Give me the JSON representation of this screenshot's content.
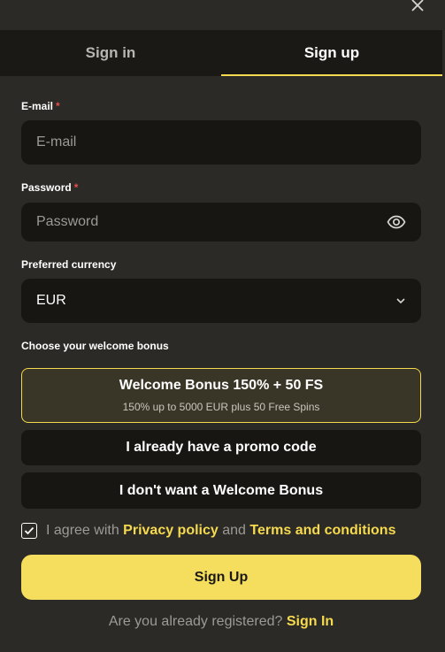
{
  "modal": {
    "close_icon": "close-icon"
  },
  "tabs": [
    {
      "label": "Sign in",
      "active": false
    },
    {
      "label": "Sign up",
      "active": true
    }
  ],
  "form": {
    "email": {
      "label": "E-mail",
      "required_mark": "*",
      "placeholder": "E-mail",
      "value": ""
    },
    "password": {
      "label": "Password",
      "required_mark": "*",
      "placeholder": "Password",
      "value": "",
      "toggle_icon": "eye-icon"
    },
    "currency": {
      "label": "Preferred currency",
      "value": "EUR",
      "icon": "chevron-down-icon"
    },
    "bonus_heading": "Choose your welcome bonus",
    "bonus_options": [
      {
        "title": "Welcome Bonus 150% + 50 FS",
        "subtitle": "150% up to 5000 EUR plus 50 Free Spins",
        "selected": true
      },
      {
        "title": "I already have a promo code",
        "selected": false
      },
      {
        "title": "I don't want a Welcome Bonus",
        "selected": false
      }
    ],
    "agreement": {
      "checked": true,
      "prefix": "I agree with",
      "privacy_link": "Privacy policy",
      "conjunction": "and",
      "terms_link": "Terms and conditions"
    },
    "submit_label": "Sign Up"
  },
  "footer": {
    "question": "Are you already registered?",
    "signin_link": "Sign In"
  },
  "colors": {
    "accent": "#f5d94e",
    "background": "#2b2a26",
    "field": "#171613",
    "required": "#e64d4d"
  }
}
